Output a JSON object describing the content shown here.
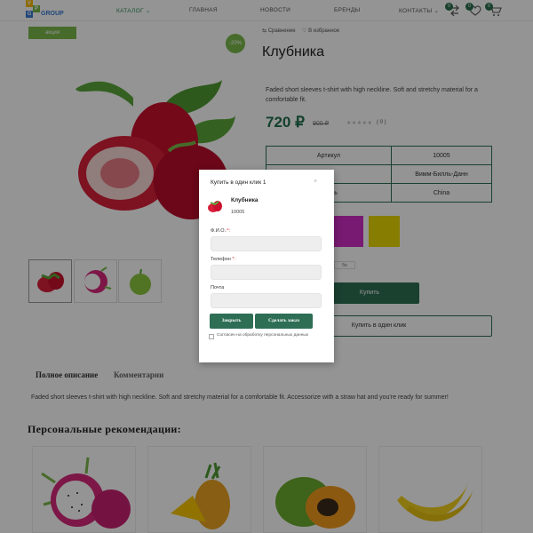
{
  "header": {
    "logo": {
      "letters": [
        "V",
        "P",
        "G"
      ],
      "text": "GROUP"
    },
    "nav": [
      {
        "label": "КАТАЛОГ",
        "active": true
      },
      {
        "label": "ГЛАВНАЯ"
      },
      {
        "label": "НОВОСТИ"
      },
      {
        "label": "БРЕНДЫ"
      },
      {
        "label": "КОНТАКТЫ"
      }
    ],
    "compare_count": "0",
    "favorites_count": "0",
    "cart_count": "0"
  },
  "product": {
    "sale_badge": "акция",
    "discount_badge": "-20%",
    "compare_label": "Сравнение",
    "favorites_label": "В избранное",
    "title": "Клубника",
    "short_description": "Faded short sleeves t-shirt with high neckline. Soft and stretchy material for a comfortable fit.",
    "price": "720 ₽",
    "old_price": "900 ₽",
    "rating_count": "( 0 )",
    "props": [
      {
        "name": "Артикул",
        "value": "10005"
      },
      {
        "name": "",
        "value": "Вимм-Билль-Данн"
      },
      {
        "name": "тель",
        "value": "China"
      }
    ],
    "size_chip": "5n",
    "buy_label": "Купить",
    "one_click_label": "Купить в один клик"
  },
  "tabs": {
    "full_description": "Полное описание",
    "comments": "Комментарии"
  },
  "full_description": "Faded short sleeves t-shirt with high neckline. Soft and stretchy material for a comfortable fit. Accessorize with a straw hat and you're ready for summer!",
  "recommendations_title": "Персональные рекомендации:",
  "modal": {
    "title": "Купить в один клик 1",
    "close": "×",
    "product_name": "Клубника",
    "product_sku": "10005",
    "fields": [
      {
        "label": "Ф.И.О.",
        "required": true
      },
      {
        "label": "Телефон",
        "required": true
      },
      {
        "label": "Почта",
        "required": false
      }
    ],
    "close_button": "Закрыть",
    "order_button": "Сделать заказ",
    "consent": "Согласен на обработку персональных данных"
  },
  "colors": {
    "accent": "#2d6e54",
    "badge": "#7ab94a",
    "swatch_magenta": "#d12ec4",
    "swatch_yellow": "#e8d800"
  },
  "icons": [
    "compare-icon",
    "heart-icon",
    "cart-icon",
    "star-icon"
  ]
}
